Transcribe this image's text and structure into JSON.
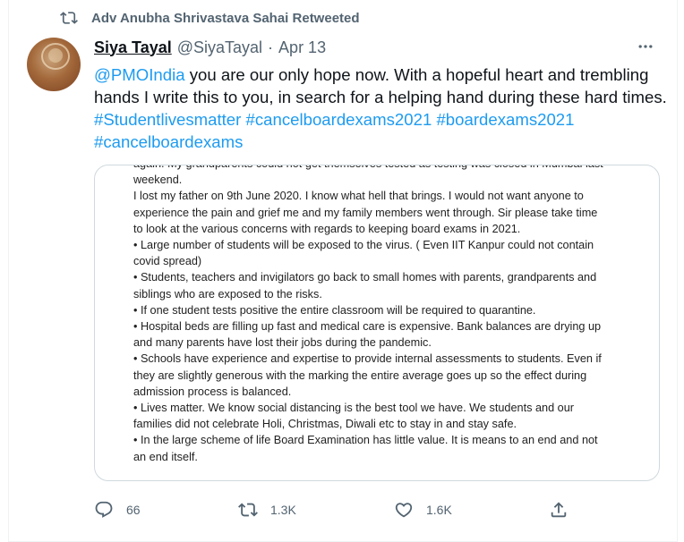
{
  "retweet": {
    "label": "Adv Anubha Shrivastava Sahai Retweeted"
  },
  "author": {
    "name": "Siya Tayal",
    "handle": "@SiyaTayal",
    "separator": "·",
    "time": "Apr 13"
  },
  "tweet": {
    "mention": "@PMOIndia",
    "text": " you are our only hope now. With a hopeful heart and trembling hands I write this to you, in search for a helping hand during these hard times. ",
    "hashtags": [
      "#Studentlivesmatter",
      "#cancelboardexams2021",
      "#boardexams2021",
      "#cancelboardexams"
    ]
  },
  "document": {
    "lines": [
      "again. My grandparents could not get themselves tested as testing was closed in Mumbai last",
      "weekend.",
      "I lost my father on 9th June 2020. I know what hell that brings. I would not want anyone to",
      "experience the pain and grief me and my family members went through. Sir please take time",
      "to look at the various concerns with regards to keeping board exams in 2021.",
      "• Large number of students will be exposed to the virus. ( Even IIT Kanpur could not contain",
      "covid spread)",
      "• Students, teachers and invigilators go back to small homes with parents, grandparents and",
      "siblings who are exposed to the risks.",
      "• If one student tests positive the entire classroom will be required to quarantine.",
      "• Hospital beds are filling up fast and medical care is expensive. Bank balances are drying up",
      "and many parents have lost their jobs during the pandemic.",
      "• Schools have experience and expertise to provide internal assessments to students. Even if",
      "they are slightly generous with the marking the entire average goes up so the effect during",
      "admission process is balanced.",
      "• Lives matter. We know social distancing is the best tool we have. We students and our",
      "families did not celebrate Holi, Christmas, Diwali etc to stay in and stay safe.",
      "• In the large scheme of life Board Examination has little value. It is means to an end and not",
      "an end itself."
    ]
  },
  "actions": {
    "reply_count": "66",
    "retweet_count": "1.3K",
    "like_count": "1.6K"
  },
  "colors": {
    "link": "#1d9bf0",
    "secondary": "#536471",
    "primary_text": "#0f1419",
    "border": "#cfd9de"
  },
  "icons": {
    "retweet_header": "retweet-icon",
    "more": "more-icon",
    "reply": "reply-icon",
    "retweet": "retweet-icon",
    "like": "heart-icon",
    "share": "share-icon"
  }
}
